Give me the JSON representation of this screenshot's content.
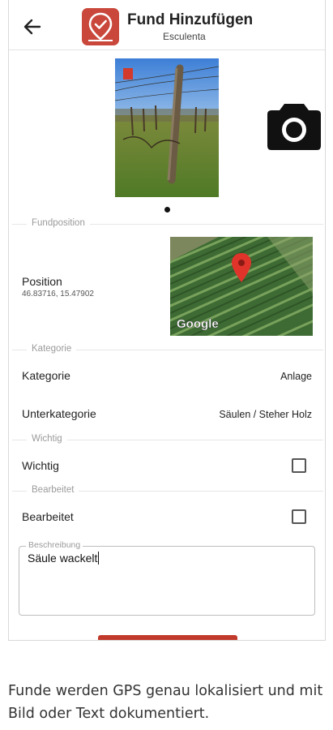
{
  "header": {
    "back_icon": "arrow-left-icon",
    "title": "Fund Hinzufügen",
    "subtitle": "Esculenta"
  },
  "photo": {
    "camera_icon": "camera-icon",
    "carousel_count": 1
  },
  "fundposition": {
    "section_label": "Fundposition",
    "position_label": "Position",
    "coordinates": "46.83716, 15.47902",
    "map_brand": "Google"
  },
  "kategorie": {
    "section_label": "Kategorie",
    "kategorie_label": "Kategorie",
    "kategorie_value": "Anlage",
    "unterkategorie_label": "Unterkategorie",
    "unterkategorie_value": "Säulen / Steher Holz"
  },
  "wichtig": {
    "section_label": "Wichtig",
    "label": "Wichtig",
    "checked": false
  },
  "bearbeitet": {
    "section_label": "Bearbeitet",
    "label": "Bearbeitet",
    "checked": false
  },
  "beschreibung": {
    "label": "Beschreibung",
    "value": "Säule wackelt"
  },
  "caption": "Funde werden GPS genau lokalisiert und mit Bild oder Text dokumentiert.",
  "colors": {
    "accent": "#c9473b",
    "divider": "#e6e6e6",
    "section_label": "#9a9a9a"
  }
}
